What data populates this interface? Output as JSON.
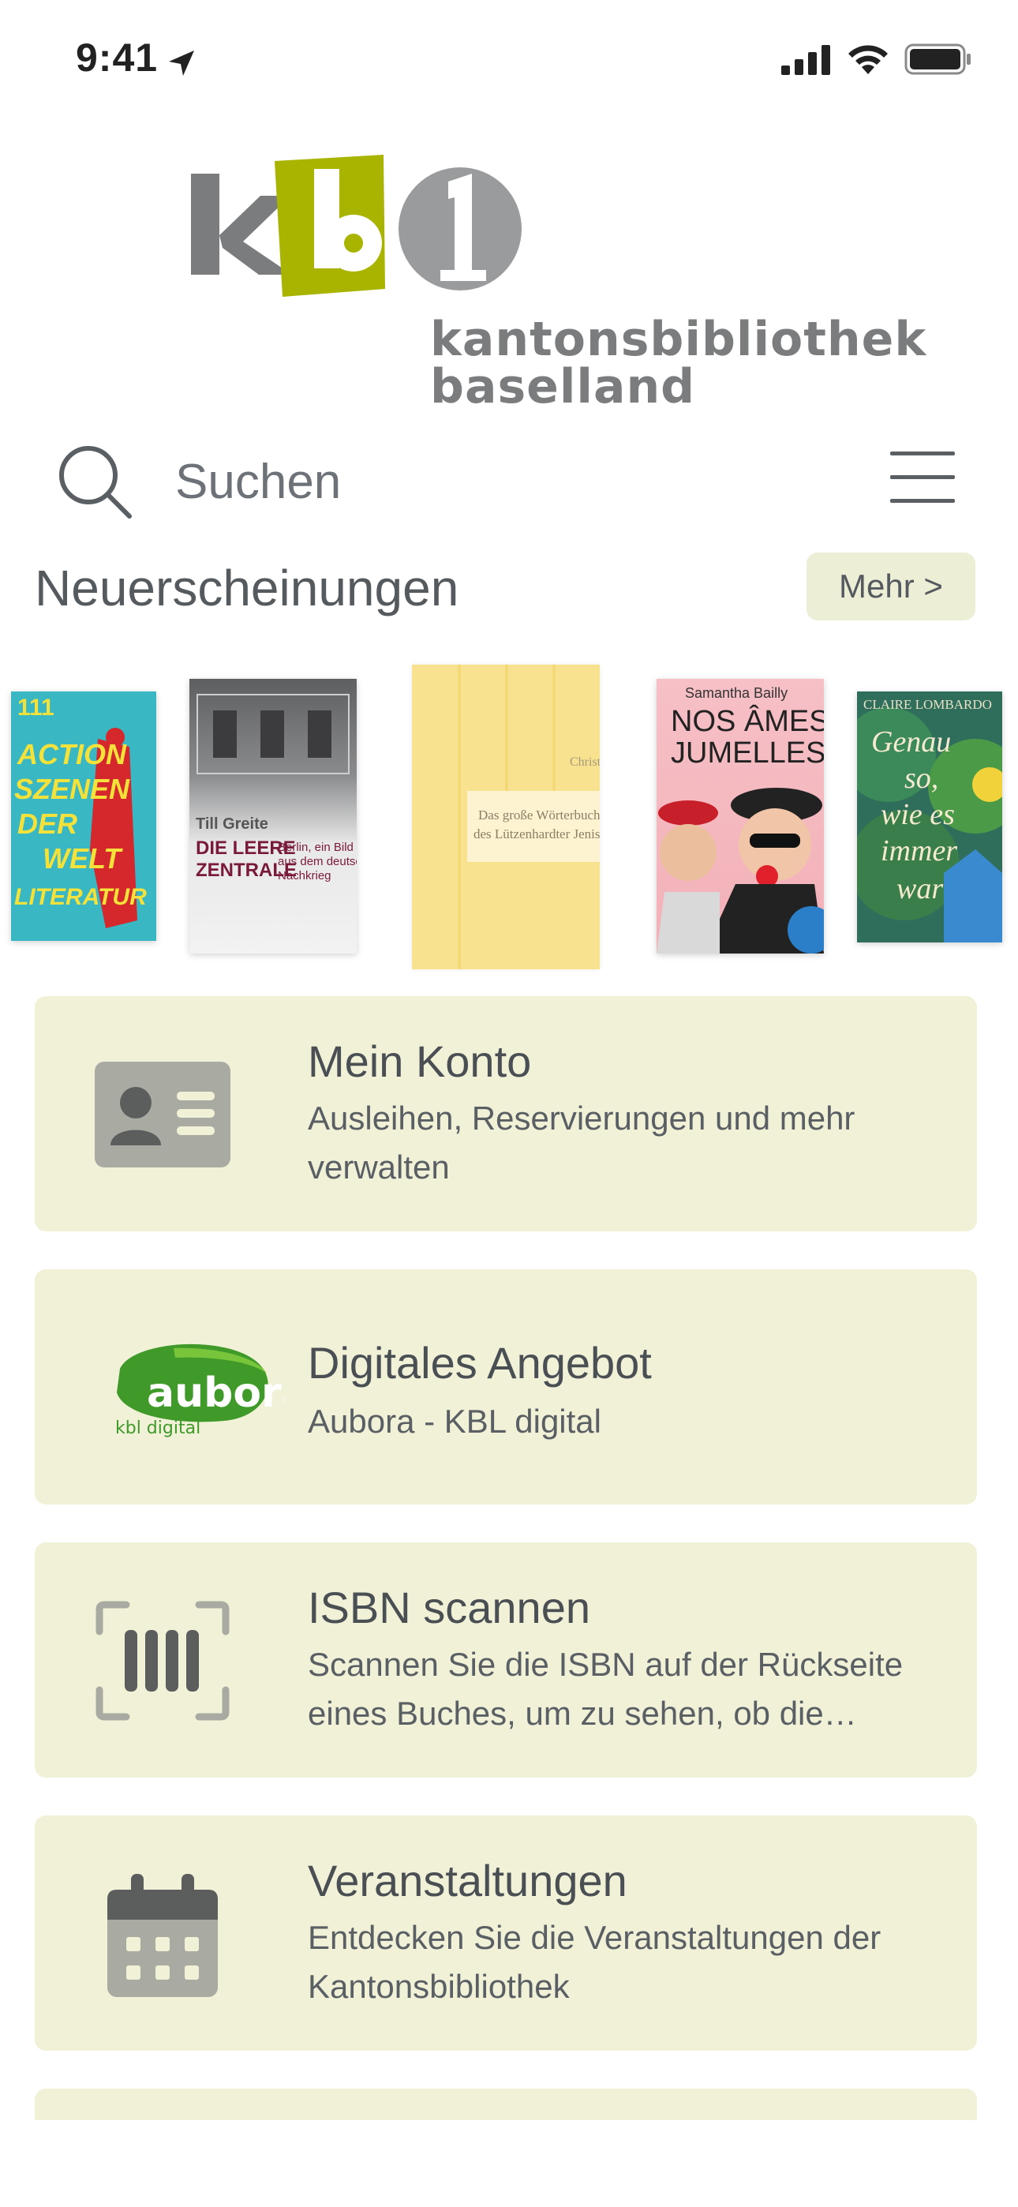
{
  "status_bar": {
    "time": "9:41"
  },
  "logo": {
    "line1": "kantonsbibliothek",
    "line2": "baselland"
  },
  "search": {
    "placeholder": "Suchen"
  },
  "new_releases": {
    "title": "Neuerscheinungen",
    "more_label": "Mehr >",
    "books": [
      {
        "lines": [
          "111",
          "ACTION",
          "SZENEN",
          "DER",
          "WELT",
          "LITERATUR"
        ]
      },
      {
        "author": "Till Greite",
        "title_lines": [
          "DIE LEERE",
          "ZENTRALE"
        ],
        "subtitle_lines": [
          "Berlin, ein Bild",
          "aus dem deutschen",
          "Nachkrieg"
        ]
      },
      {
        "author": "Christian Ehr",
        "title_lines": [
          "Das große Wörterbuch",
          "des Lützenhardter Jenisch"
        ]
      },
      {
        "author": "Samantha Bailly",
        "title_lines": [
          "NOS ÂMES",
          "JUMELLES"
        ]
      },
      {
        "author": "CLAIRE LOMBARDO",
        "title_lines": [
          "Genau",
          "so,",
          "wie es",
          "immer",
          "war"
        ]
      }
    ]
  },
  "menu_cards": [
    {
      "title": "Mein Konto",
      "subtitle": "Ausleihen, Reservierungen und mehr verwalten",
      "icon": "id-card-icon"
    },
    {
      "title": "Digitales Angebot",
      "subtitle": "Aubora - KBL digital",
      "icon": "aubora-logo",
      "logo_text": "aubora",
      "logo_sub": "kbl digital"
    },
    {
      "title": "ISBN scannen",
      "subtitle": "Scannen Sie die ISBN auf der Rückseite eines Buches, um zu sehen, ob die…",
      "icon": "barcode-scan-icon"
    },
    {
      "title": "Veranstaltungen",
      "subtitle": "Entdecken Sie die Veranstaltungen der Kantonsbibliothek",
      "icon": "calendar-icon"
    }
  ],
  "colors": {
    "card_bg": "#f1f1d8",
    "accent": "#a8b400",
    "gray": "#7b7c7e"
  }
}
